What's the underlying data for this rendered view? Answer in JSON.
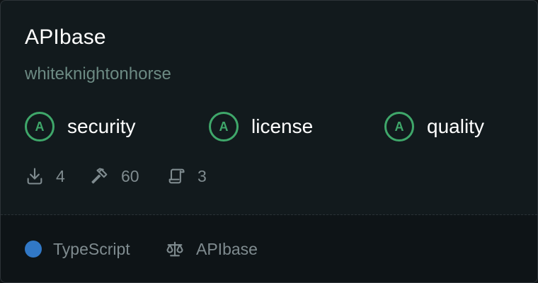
{
  "package": {
    "name": "APIbase",
    "owner": "whiteknightonhorse"
  },
  "scores": [
    {
      "grade": "A",
      "label": "security"
    },
    {
      "grade": "A",
      "label": "license"
    },
    {
      "grade": "A",
      "label": "quality"
    }
  ],
  "stats": {
    "downloads": "4",
    "builds": "60",
    "versions": "3"
  },
  "footer": {
    "language": "TypeScript",
    "language_color": "#3178c6",
    "license": "APIbase"
  },
  "icons": {
    "downloads": "download-icon",
    "builds": "hammer-icon",
    "versions": "scroll-icon",
    "license": "scale-icon"
  },
  "colors": {
    "grade_accent": "#3fa76a",
    "owner_text": "#6c8a83",
    "muted_text": "#7f8b8f"
  }
}
